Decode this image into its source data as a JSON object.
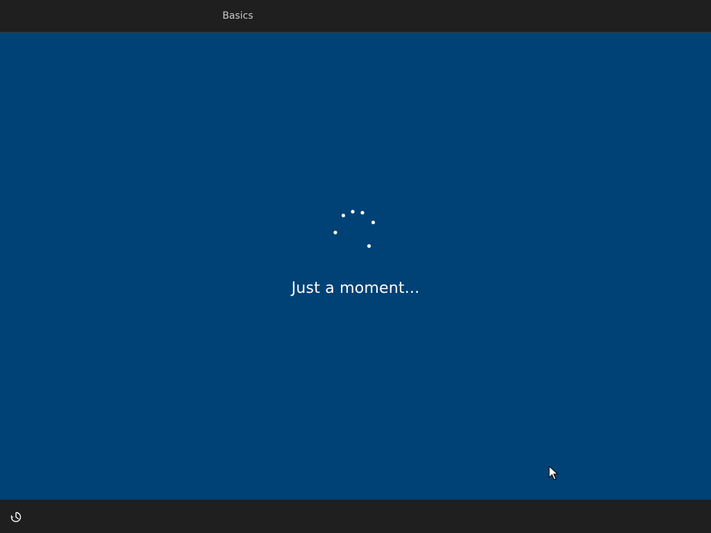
{
  "header": {
    "tabs": [
      {
        "label": "Basics",
        "active": true
      }
    ]
  },
  "main": {
    "status_message": "Just a moment...",
    "spinner_icon": "loading-dots-icon"
  },
  "footer": {
    "accessibility_icon": "ease-of-access-icon"
  },
  "colors": {
    "chrome": "#1f1f1f",
    "background": "#004275",
    "text": "#ffffff",
    "tab_text": "#c9c9c9"
  }
}
